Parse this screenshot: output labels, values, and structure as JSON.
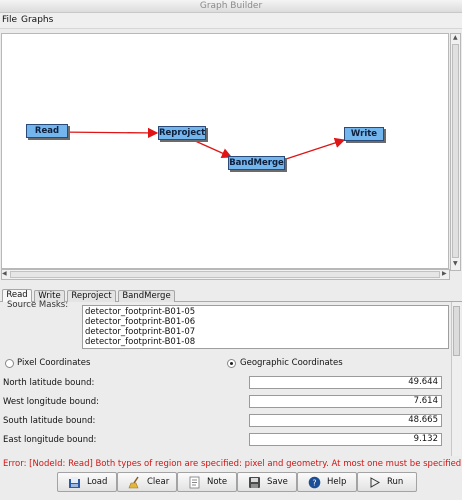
{
  "window": {
    "title": "Graph Builder"
  },
  "menu": {
    "items": [
      "File",
      "Graphs"
    ]
  },
  "graph": {
    "nodes": {
      "read": "Read",
      "reproject": "Reproject",
      "bandmerge": "BandMerge",
      "write": "Write"
    }
  },
  "tabs": [
    "Read",
    "Write",
    "Reproject",
    "BandMerge"
  ],
  "read_panel": {
    "masks_label": "Source Masks:",
    "masks": [
      "detector_footprint-B01-05",
      "detector_footprint-B01-06",
      "detector_footprint-B01-07",
      "detector_footprint-B01-08"
    ],
    "pixel_coords_label": "Pixel Coordinates",
    "geo_coords_label": "Geographic Coordinates",
    "geo_selected": true,
    "fields": [
      {
        "label": "North latitude bound:",
        "value": "49.644"
      },
      {
        "label": "West longitude bound:",
        "value": "7.614"
      },
      {
        "label": "South latitude bound:",
        "value": "48.665"
      },
      {
        "label": "East longitude bound:",
        "value": "9.132"
      }
    ]
  },
  "status": {
    "error": "Error: [NodeId: Read] Both types of region are specified: pixel and geometry. At most one must be specified."
  },
  "buttons": {
    "load": "Load",
    "clear": "Clear",
    "note": "Note",
    "save": "Save",
    "help": "Help",
    "run": "Run"
  },
  "colors": {
    "node_fill": "#73b6ee",
    "edge": "#e01414",
    "error": "#d21414"
  }
}
